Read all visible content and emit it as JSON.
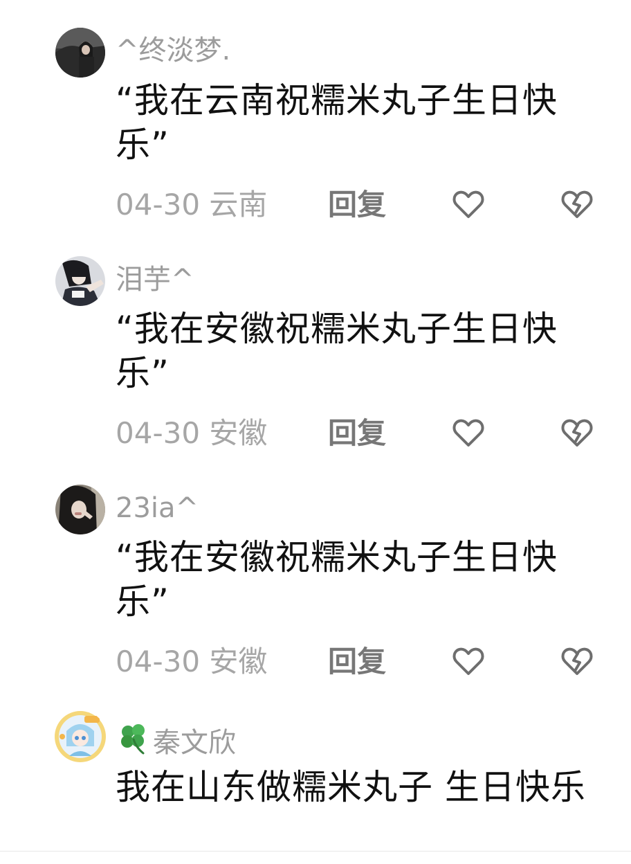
{
  "comments": [
    {
      "username": "^终淡梦.",
      "text": "“我在云南祝糯米丸子生日快乐”",
      "date": "04-30",
      "location": "云南",
      "reply_label": "回复",
      "avatar_icon": "avatar-dark-car-photo"
    },
    {
      "username": "泪芋^",
      "text": "“我在安徽祝糯米丸子生日快乐”",
      "date": "04-30",
      "location": "安徽",
      "reply_label": "回复",
      "avatar_icon": "avatar-girl-photo"
    },
    {
      "username": "23ia^",
      "text": "“我在安徽祝糯米丸子生日快乐”",
      "date": "04-30",
      "location": "安徽",
      "reply_label": "回复",
      "avatar_icon": "avatar-dark-hair-photo"
    },
    {
      "username": "秦文欣",
      "username_icon": "clover-icon",
      "text": "我在山东做糯米丸子 生日快乐",
      "avatar_icon": "avatar-anime-badge"
    }
  ],
  "icons": {
    "like": "heart-outline-icon",
    "dislike": "broken-heart-icon"
  },
  "colors": {
    "username": "#9c9c9c",
    "text": "#111111",
    "meta": "#a6a6a6",
    "reply": "#777777",
    "icon_stroke": "#6e6e6e",
    "clover": "#3fa34d"
  }
}
